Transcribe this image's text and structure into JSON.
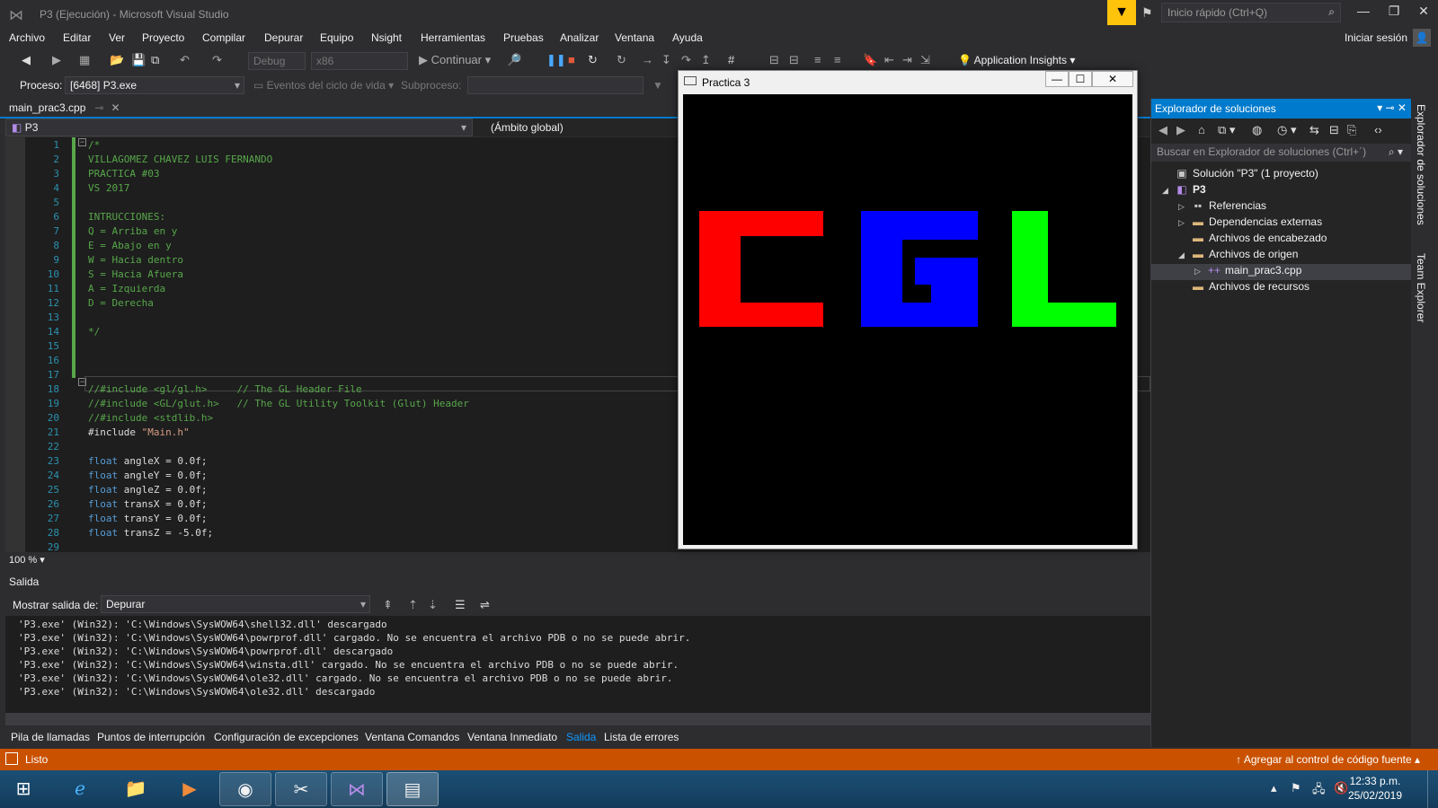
{
  "window": {
    "title": "P3 (Ejecución) - Microsoft Visual Studio"
  },
  "quick_launch": {
    "placeholder": "Inicio rápido (Ctrl+Q)"
  },
  "menu": [
    "Archivo",
    "Editar",
    "Ver",
    "Proyecto",
    "Compilar",
    "Depurar",
    "Equipo",
    "Nsight",
    "Herramientas",
    "Pruebas",
    "Analizar",
    "Ventana",
    "Ayuda"
  ],
  "account": {
    "signin": "Iniciar sesión"
  },
  "toolbar": {
    "config": "Debug",
    "platform": "x86",
    "continue": "Continuar",
    "app_insights": "Application Insights"
  },
  "process_bar": {
    "process_label": "Proceso:",
    "process_value": "[6468] P3.exe",
    "lifecycle": "Eventos del ciclo de vida",
    "thread_label": "Subproceso:"
  },
  "editor": {
    "tab": "main_prac3.cpp",
    "nav_project": "P3",
    "nav_scope": "(Ámbito global)",
    "zoom": "100 %",
    "lines": [
      {
        "n": "1",
        "parts": [
          {
            "t": "/*",
            "c": "com"
          }
        ]
      },
      {
        "n": "2",
        "parts": [
          {
            "t": "VILLAGOMEZ CHAVEZ LUIS FERNANDO",
            "c": "com"
          }
        ]
      },
      {
        "n": "3",
        "parts": [
          {
            "t": "PRACTICA #03",
            "c": "com"
          }
        ]
      },
      {
        "n": "4",
        "parts": [
          {
            "t": "VS 2017",
            "c": "com"
          }
        ]
      },
      {
        "n": "5",
        "parts": [
          {
            "t": "",
            "c": "com"
          }
        ]
      },
      {
        "n": "6",
        "parts": [
          {
            "t": "INTRUCCIONES:",
            "c": "com"
          }
        ]
      },
      {
        "n": "7",
        "parts": [
          {
            "t": "Q = Arriba en y",
            "c": "com"
          }
        ]
      },
      {
        "n": "8",
        "parts": [
          {
            "t": "E = Abajo en y",
            "c": "com"
          }
        ]
      },
      {
        "n": "9",
        "parts": [
          {
            "t": "W = Hacia dentro",
            "c": "com"
          }
        ]
      },
      {
        "n": "10",
        "parts": [
          {
            "t": "S = Hacia Afuera",
            "c": "com"
          }
        ]
      },
      {
        "n": "11",
        "parts": [
          {
            "t": "A = Izquierda",
            "c": "com"
          }
        ]
      },
      {
        "n": "12",
        "parts": [
          {
            "t": "D = Derecha",
            "c": "com"
          }
        ]
      },
      {
        "n": "13",
        "parts": [
          {
            "t": "",
            "c": "com"
          }
        ]
      },
      {
        "n": "14",
        "parts": [
          {
            "t": "*/",
            "c": "com"
          }
        ]
      },
      {
        "n": "15",
        "parts": []
      },
      {
        "n": "16",
        "parts": []
      },
      {
        "n": "17",
        "parts": []
      },
      {
        "n": "18",
        "parts": [
          {
            "t": "//#include <gl/gl.h>     // The GL Header File",
            "c": "com"
          }
        ]
      },
      {
        "n": "19",
        "parts": [
          {
            "t": "//#include <GL/glut.h>   // The GL Utility Toolkit (Glut) Header",
            "c": "com"
          }
        ]
      },
      {
        "n": "20",
        "parts": [
          {
            "t": "//#include <stdlib.h>",
            "c": "com"
          }
        ]
      },
      {
        "n": "21",
        "parts": [
          {
            "t": "#include ",
            "c": "plain"
          },
          {
            "t": "\"Main.h\"",
            "c": "str"
          }
        ]
      },
      {
        "n": "22",
        "parts": []
      },
      {
        "n": "23",
        "parts": [
          {
            "t": "float",
            "c": "kw"
          },
          {
            "t": " angleX = 0.0f;",
            "c": "plain"
          }
        ]
      },
      {
        "n": "24",
        "parts": [
          {
            "t": "float",
            "c": "kw"
          },
          {
            "t": " angleY = 0.0f;",
            "c": "plain"
          }
        ]
      },
      {
        "n": "25",
        "parts": [
          {
            "t": "float",
            "c": "kw"
          },
          {
            "t": " angleZ = 0.0f;",
            "c": "plain"
          }
        ]
      },
      {
        "n": "26",
        "parts": [
          {
            "t": "float",
            "c": "kw"
          },
          {
            "t": " transX = 0.0f;",
            "c": "plain"
          }
        ]
      },
      {
        "n": "27",
        "parts": [
          {
            "t": "float",
            "c": "kw"
          },
          {
            "t": " transY = 0.0f;",
            "c": "plain"
          }
        ]
      },
      {
        "n": "28",
        "parts": [
          {
            "t": "float",
            "c": "kw"
          },
          {
            "t": " transZ = -5.0f;",
            "c": "plain"
          }
        ]
      },
      {
        "n": "29",
        "parts": []
      }
    ]
  },
  "output": {
    "title": "Salida",
    "show_label": "Mostrar salida de:",
    "source": "Depurar",
    "lines": [
      "'P3.exe' (Win32): 'C:\\Windows\\SysWOW64\\shell32.dll' descargado",
      "'P3.exe' (Win32): 'C:\\Windows\\SysWOW64\\powrprof.dll' cargado. No se encuentra el archivo PDB o no se puede abrir.",
      "'P3.exe' (Win32): 'C:\\Windows\\SysWOW64\\powrprof.dll' descargado",
      "'P3.exe' (Win32): 'C:\\Windows\\SysWOW64\\winsta.dll' cargado. No se encuentra el archivo PDB o no se puede abrir.",
      "'P3.exe' (Win32): 'C:\\Windows\\SysWOW64\\ole32.dll' cargado. No se encuentra el archivo PDB o no se puede abrir.",
      "'P3.exe' (Win32): 'C:\\Windows\\SysWOW64\\ole32.dll' descargado"
    ]
  },
  "bottom_tabs": [
    "Pila de llamadas",
    "Puntos de interrupción",
    "Configuración de excepciones",
    "Ventana Comandos",
    "Ventana Inmediato",
    "Salida",
    "Lista de errores"
  ],
  "bottom_tab_active": "Salida",
  "status": {
    "text": "Listo",
    "scm": "Agregar al control de código fuente",
    "color": "#ca5100"
  },
  "solution_explorer": {
    "title": "Explorador de soluciones",
    "search_placeholder": "Buscar en Explorador de soluciones (Ctrl+´)",
    "tree": [
      {
        "label": "Solución \"P3\"  (1 proyecto)",
        "icon": "solution-icon"
      },
      {
        "label": "P3",
        "icon": "project-icon",
        "bold": true
      },
      {
        "label": "Referencias",
        "icon": "references-icon"
      },
      {
        "label": "Dependencias externas",
        "icon": "folder-icon"
      },
      {
        "label": "Archivos de encabezado",
        "icon": "folder-icon"
      },
      {
        "label": "Archivos de origen",
        "icon": "folder-icon"
      },
      {
        "label": "main_prac3.cpp",
        "icon": "cpp-file-icon"
      },
      {
        "label": "Archivos de recursos",
        "icon": "folder-icon"
      }
    ]
  },
  "side_tabs": [
    "Explorador de soluciones",
    "Team Explorer"
  ],
  "gl_window": {
    "title": "Practica 3",
    "colors": {
      "c": "#ff0000",
      "g": "#0000ff",
      "l": "#00ff00"
    }
  },
  "taskbar": {
    "time": "12:33 p.m.",
    "date": "25/02/2019"
  }
}
